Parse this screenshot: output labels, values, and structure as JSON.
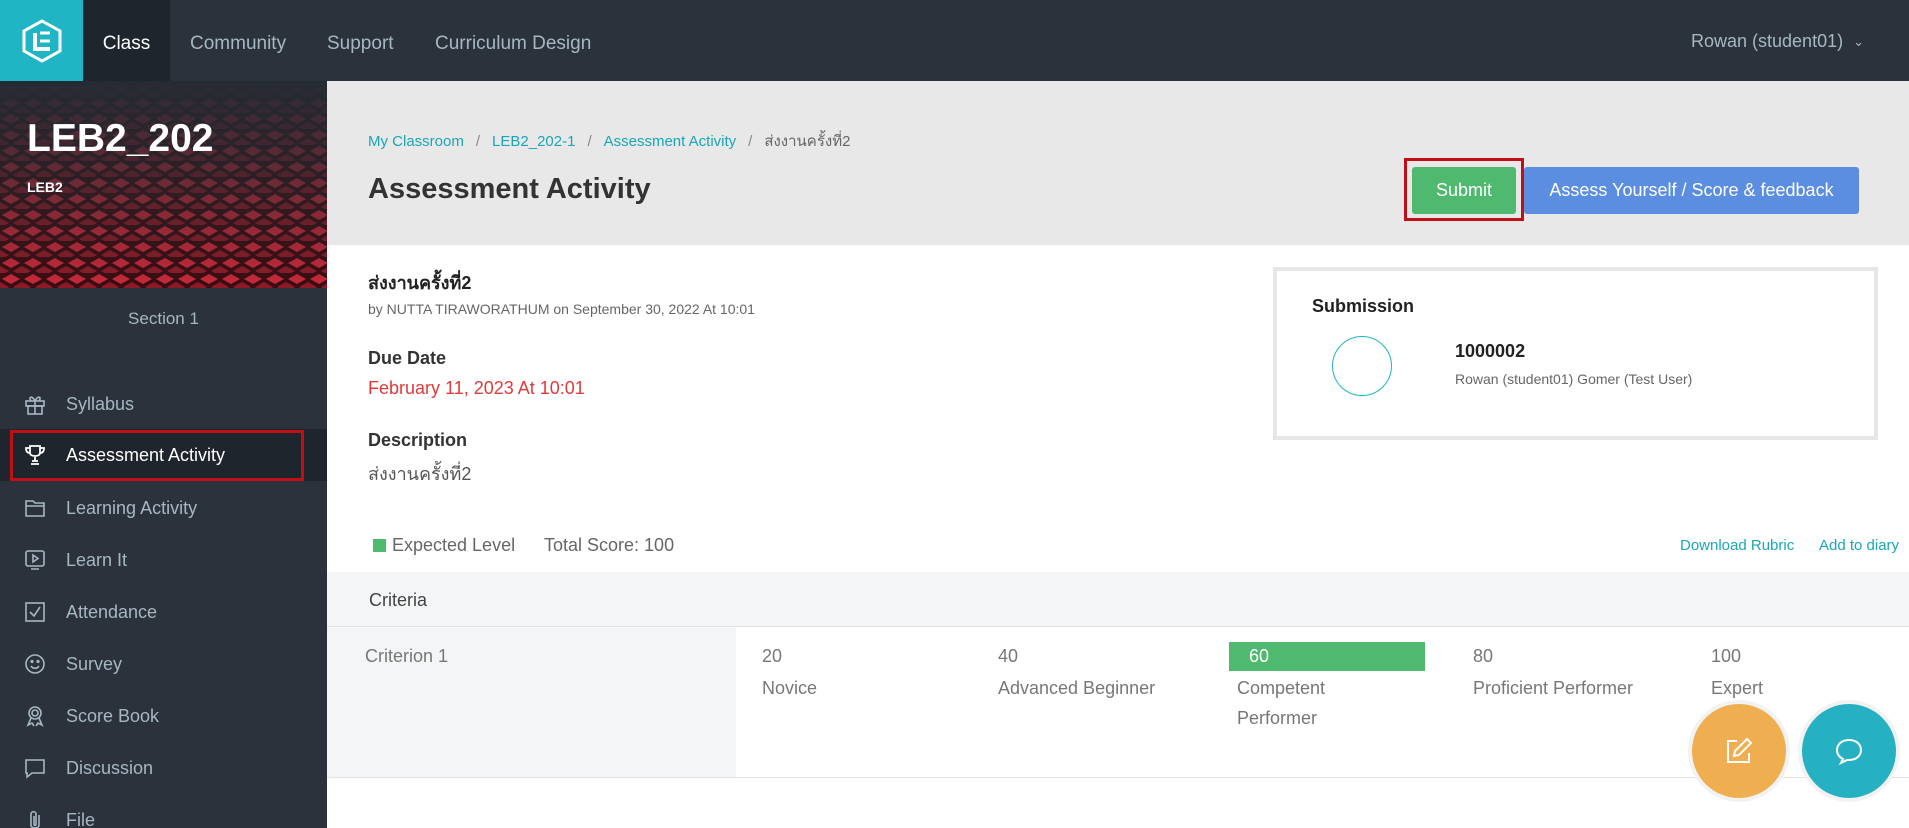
{
  "topnav": {
    "items": [
      "Class",
      "Community",
      "Support",
      "Curriculum Design"
    ],
    "user": "Rowan (student01)"
  },
  "sidebar": {
    "course_code": "LEB2_202",
    "course_sub": "LEB2",
    "section": "Section 1",
    "items": [
      {
        "label": "Syllabus",
        "icon": "gift-icon"
      },
      {
        "label": "Assessment Activity",
        "icon": "trophy-icon"
      },
      {
        "label": "Learning Activity",
        "icon": "folder-icon"
      },
      {
        "label": "Learn It",
        "icon": "play-icon"
      },
      {
        "label": "Attendance",
        "icon": "checkbox-icon"
      },
      {
        "label": "Survey",
        "icon": "smiley-icon"
      },
      {
        "label": "Score Book",
        "icon": "award-icon"
      },
      {
        "label": "Discussion",
        "icon": "speech-bubble-icon"
      },
      {
        "label": "File",
        "icon": "paperclip-icon"
      }
    ]
  },
  "breadcrumb": [
    "My Classroom",
    "LEB2_202-1",
    "Assessment Activity",
    "ส่งงานครั้งที่2"
  ],
  "page_title": "Assessment Activity",
  "buttons": {
    "submit": "Submit",
    "assess": "Assess Yourself / Score & feedback"
  },
  "assignment": {
    "title": "ส่งงานครั้งที่2",
    "by": "by NUTTA TIRAWORATHUM on September 30, 2022 At 10:01",
    "due_heading": "Due Date",
    "due_value": "February 11, 2023 At 10:01",
    "desc_heading": "Description",
    "desc_value": "ส่งงานครั้งที่2"
  },
  "submission": {
    "heading": "Submission",
    "id": "1000002",
    "name": "Rowan (student01) Gomer (Test User)"
  },
  "rubric": {
    "legend": "Expected Level",
    "total": "Total Score: 100",
    "download": "Download Rubric",
    "add_diary": "Add to diary",
    "criteria_header": "Criteria",
    "criterion": "Criterion 1",
    "levels": [
      {
        "score": "20",
        "label": "Novice"
      },
      {
        "score": "40",
        "label": "Advanced Beginner"
      },
      {
        "score": "60",
        "label": "Competent Performer"
      },
      {
        "score": "80",
        "label": "Proficient Performer"
      },
      {
        "score": "100",
        "label": "Expert"
      }
    ]
  },
  "colors": {
    "accent": "#1fb5c4",
    "success": "#4fb96f",
    "primary": "#5b8ee0",
    "danger": "#e03a3a",
    "highlight": "#c10f16"
  }
}
